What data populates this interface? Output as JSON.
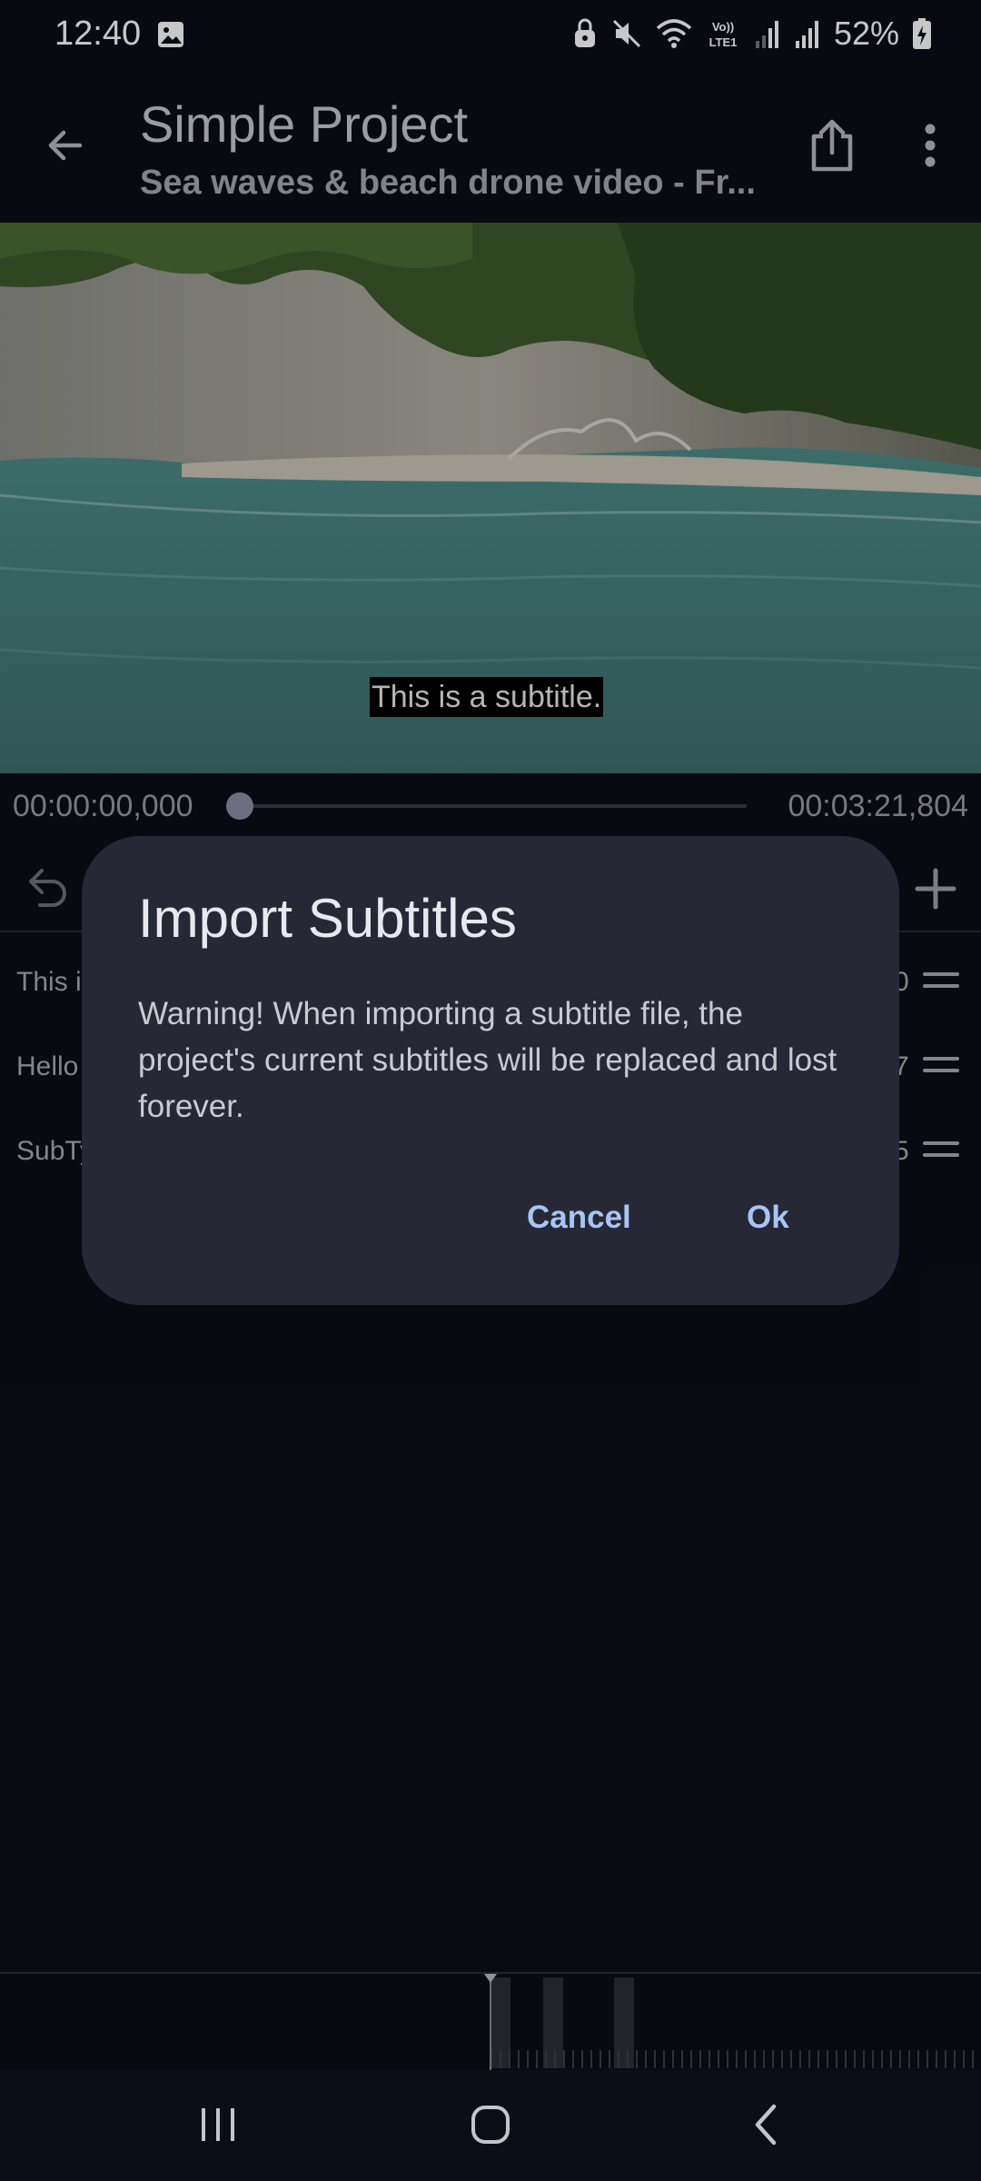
{
  "status_bar": {
    "time": "12:40",
    "battery": "52%",
    "icons": [
      "gallery-icon",
      "lock-icon",
      "mute-icon",
      "wifi-icon",
      "volte-icon",
      "signal-icon",
      "signal-icon",
      "battery-icon"
    ]
  },
  "app_bar": {
    "title": "Simple Project",
    "subtitle": "Sea waves & beach drone video - Fr...",
    "icons": [
      "back-arrow-icon",
      "share-icon",
      "more-vert-icon"
    ]
  },
  "video": {
    "subtitle_text": "This is a subtitle."
  },
  "player": {
    "current_time": "00:00:00,000",
    "total_time": "00:03:21,804",
    "progress": 0
  },
  "toolbar": {
    "icons": [
      "undo-icon",
      "add-icon"
    ]
  },
  "subtitles": [
    {
      "text_visible": "This i",
      "end_visible": "0"
    },
    {
      "text_visible": "Hello",
      "end_visible": "7"
    },
    {
      "text_visible": "SubTy",
      "end_visible": "5"
    }
  ],
  "dialog": {
    "title": "Import Subtitles",
    "message": "Warning! When importing a subtitle file, the project's current subtitles will be replaced and lost forever.",
    "cancel_label": "Cancel",
    "ok_label": "Ok"
  },
  "nav_bar": {
    "icons": [
      "recents-icon",
      "home-icon",
      "back-icon"
    ]
  },
  "colors": {
    "background": "#0b0e17",
    "dialog": "#262935",
    "accent": "#a9c4f5"
  }
}
